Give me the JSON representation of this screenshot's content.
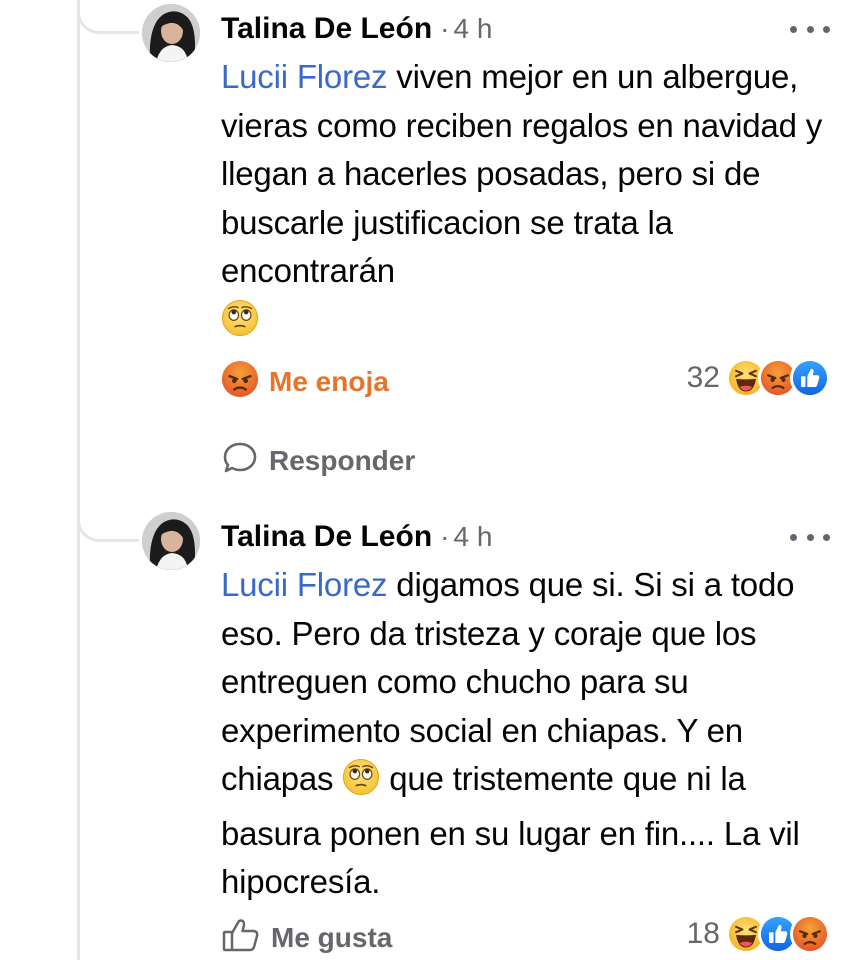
{
  "comments": [
    {
      "author": "Talina De León",
      "separator": "·",
      "time": "4 h",
      "mention": "Lucii Florez",
      "text": " viven mejor en un albergue, vieras como reciben regalos en navidad y llegan a hacerles posadas, pero si de buscarle justificacion se trata la encontrarán ",
      "trailing_emoji": "eye-roll-emoji",
      "my_reaction": {
        "icon": "angry-reaction-icon",
        "label": "Me enoja",
        "color": "#e4752b"
      },
      "reply_label": "Responder",
      "reaction_count": "32",
      "reaction_icons": [
        "haha-reaction-icon",
        "angry-reaction-icon",
        "like-reaction-icon"
      ]
    },
    {
      "author": "Talina De León",
      "separator": "·",
      "time": "4 h",
      "mention": "Lucii Florez",
      "text_before_emoji": " digamos que si. Si si a todo eso. Pero da tristeza y coraje que los entreguen como chucho para su experimento social en chiapas. Y en chiapas ",
      "inline_emoji": "eye-roll-emoji",
      "text_after_emoji": " que tristemente que ni la basura ponen en su lugar en fin.... La vil hipocresía.",
      "my_reaction": {
        "icon": "like-outline-icon",
        "label": "Me gusta",
        "color": "#65676b"
      },
      "reaction_count": "18",
      "reaction_icons": [
        "haha-reaction-icon",
        "like-reaction-icon",
        "angry-reaction-icon"
      ]
    }
  ],
  "colors": {
    "mention": "#3a69c9",
    "like_blue": "#1877f2",
    "angry_orange": "#e4752b",
    "secondary_text": "#65676b"
  }
}
